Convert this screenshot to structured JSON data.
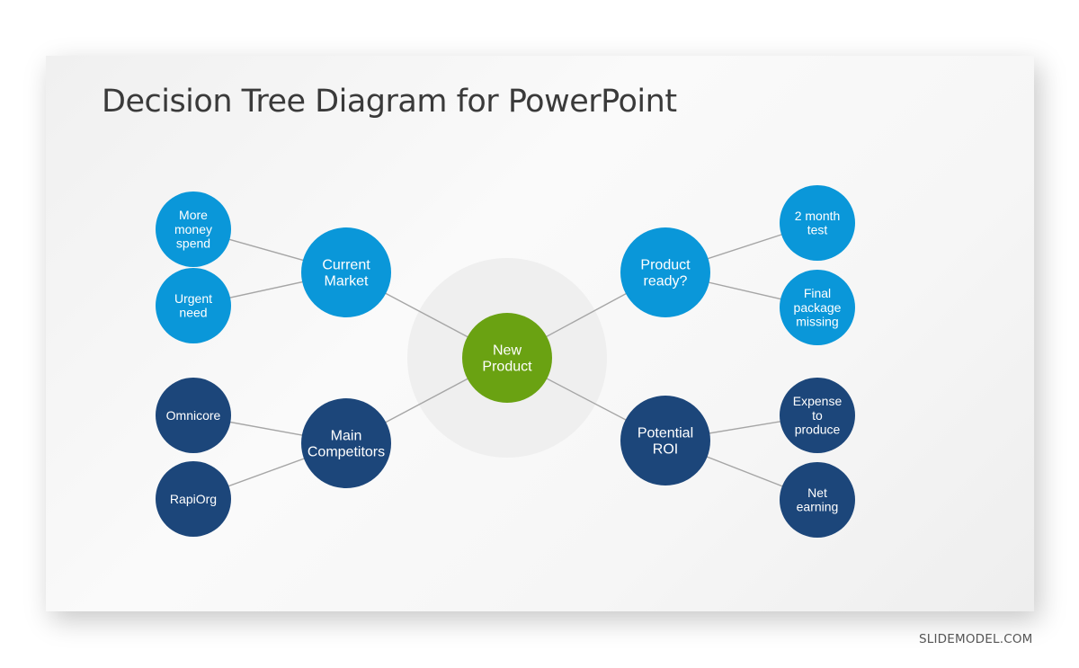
{
  "title": "Decision Tree Diagram for PowerPoint",
  "watermark": "SLIDEMODEL.COM",
  "colors": {
    "root": "#6aa212",
    "light_blue": "#0a97d9",
    "dark_blue": "#1c467a",
    "halo": "#efefef",
    "connector": "#a6a6a6"
  },
  "diagram": {
    "root": {
      "id": "new-product",
      "lines": [
        "New",
        "Product"
      ],
      "color": "root"
    },
    "branches": [
      {
        "id": "current-market",
        "side": "left",
        "color": "light_blue",
        "lines": [
          "Current",
          "Market"
        ],
        "children": [
          {
            "id": "more-money-spend",
            "lines": [
              "More",
              "money",
              "spend"
            ]
          },
          {
            "id": "urgent-need",
            "lines": [
              "Urgent",
              "need"
            ]
          }
        ]
      },
      {
        "id": "main-competitors",
        "side": "left",
        "color": "dark_blue",
        "lines": [
          "Main",
          "Competitors"
        ],
        "children": [
          {
            "id": "omnicore",
            "lines": [
              "Omnicore"
            ]
          },
          {
            "id": "rapiorg",
            "lines": [
              "RapiOrg"
            ]
          }
        ]
      },
      {
        "id": "product-ready",
        "side": "right",
        "color": "light_blue",
        "lines": [
          "Product",
          "ready?"
        ],
        "children": [
          {
            "id": "2-month-test",
            "lines": [
              "2 month",
              "test"
            ]
          },
          {
            "id": "final-package-missing",
            "lines": [
              "Final",
              "package",
              "missing"
            ]
          }
        ]
      },
      {
        "id": "potential-roi",
        "side": "right",
        "color": "dark_blue",
        "lines": [
          "Potential",
          "ROI"
        ],
        "children": [
          {
            "id": "expense-to-produce",
            "lines": [
              "Expense",
              "to",
              "produce"
            ]
          },
          {
            "id": "net-earning",
            "lines": [
              "Net",
              "earning"
            ]
          }
        ]
      }
    ]
  }
}
